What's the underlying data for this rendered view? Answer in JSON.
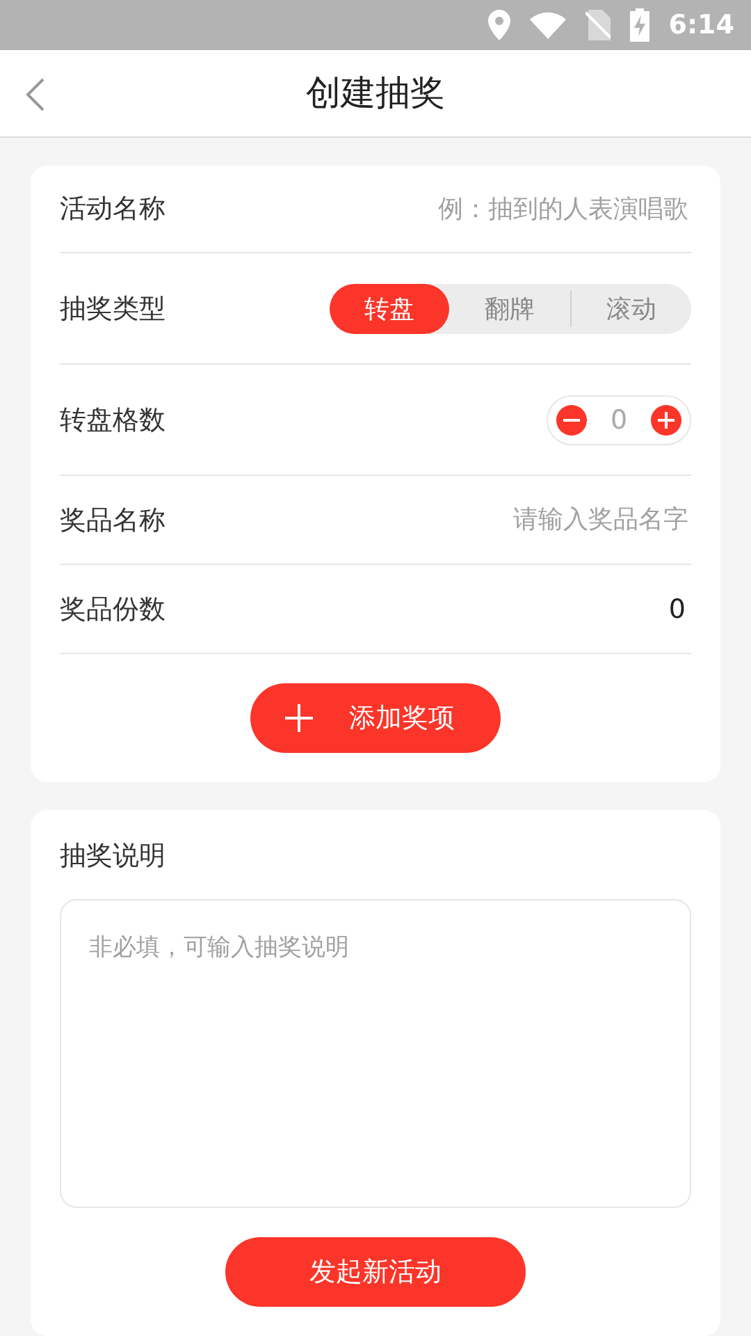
{
  "status_bar": {
    "time": "6:14"
  },
  "header": {
    "title": "创建抽奖"
  },
  "form": {
    "fields": [
      {
        "kind": "text",
        "label": "活动名称",
        "placeholder": "例：抽到的人表演唱歌"
      },
      {
        "kind": "segmented",
        "label": "抽奖类型",
        "options": [
          {
            "label": "转盘",
            "selected": true
          },
          {
            "label": "翻牌",
            "selected": false
          },
          {
            "label": "滚动",
            "selected": false
          }
        ]
      },
      {
        "kind": "stepper",
        "label": "转盘格数",
        "value": "0"
      },
      {
        "kind": "text",
        "label": "奖品名称",
        "placeholder": "请输入奖品名字"
      },
      {
        "kind": "value",
        "label": "奖品份数",
        "value": "0"
      }
    ],
    "add_button": {
      "label": "添加奖项"
    }
  },
  "description": {
    "label": "抽奖说明",
    "placeholder": "非必填，可输入抽奖说明"
  },
  "submit_button": {
    "label": "发起新活动"
  }
}
